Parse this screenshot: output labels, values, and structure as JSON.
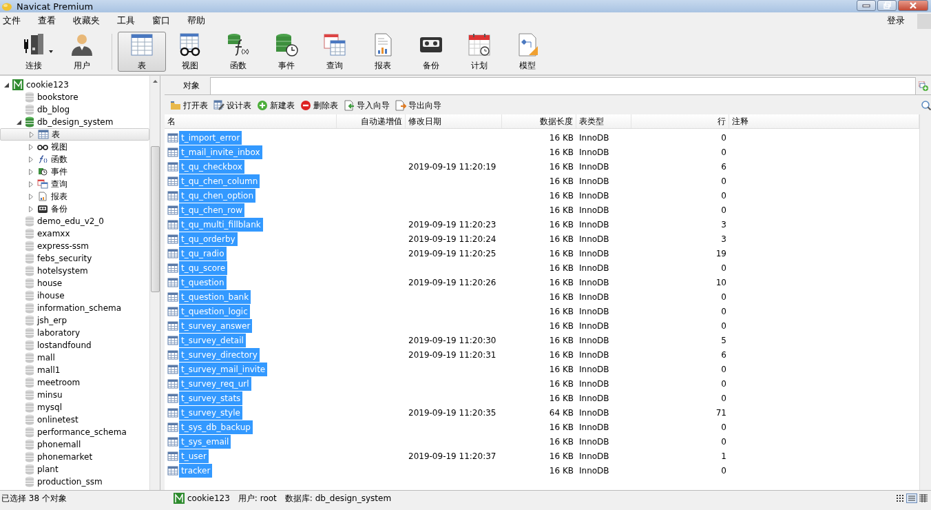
{
  "window": {
    "title": "Navicat Premium"
  },
  "menu": [
    "文件",
    "查看",
    "收藏夹",
    "工具",
    "窗口",
    "帮助"
  ],
  "login": "登录",
  "toolbar": [
    {
      "label": "连接",
      "kind": "connect",
      "selected": false,
      "dropdown": true
    },
    {
      "label": "用户",
      "kind": "user",
      "selected": false
    },
    {
      "label": "表",
      "kind": "table",
      "selected": true
    },
    {
      "label": "视图",
      "kind": "view",
      "selected": false
    },
    {
      "label": "函数",
      "kind": "function",
      "selected": false
    },
    {
      "label": "事件",
      "kind": "event",
      "selected": false
    },
    {
      "label": "查询",
      "kind": "query",
      "selected": false
    },
    {
      "label": "报表",
      "kind": "report",
      "selected": false
    },
    {
      "label": "备份",
      "kind": "backup",
      "selected": false
    },
    {
      "label": "计划",
      "kind": "schedule",
      "selected": false
    },
    {
      "label": "模型",
      "kind": "model",
      "selected": false
    }
  ],
  "sidebar": {
    "items": [
      {
        "label": "cookie123",
        "kind": "connection",
        "expanded": true,
        "selected": false,
        "children": [
          {
            "label": "bookstore",
            "kind": "database",
            "selected": false
          },
          {
            "label": "db_blog",
            "kind": "database",
            "selected": false
          },
          {
            "label": "db_design_system",
            "kind": "database",
            "expanded": true,
            "selected": false,
            "children": [
              {
                "label": "表",
                "kind": "table",
                "expanded": false,
                "selected": true
              },
              {
                "label": "视图",
                "kind": "view",
                "expanded": false,
                "selected": false
              },
              {
                "label": "函数",
                "kind": "function",
                "expanded": false,
                "selected": false
              },
              {
                "label": "事件",
                "kind": "event",
                "expanded": false,
                "selected": false
              },
              {
                "label": "查询",
                "kind": "query",
                "expanded": false,
                "selected": false
              },
              {
                "label": "报表",
                "kind": "report",
                "expanded": false,
                "selected": false
              },
              {
                "label": "备份",
                "kind": "backup",
                "expanded": false,
                "selected": false
              }
            ]
          },
          {
            "label": "demo_edu_v2_0",
            "kind": "database",
            "selected": false
          },
          {
            "label": "examxx",
            "kind": "database",
            "selected": false
          },
          {
            "label": "express-ssm",
            "kind": "database",
            "selected": false
          },
          {
            "label": "febs_security",
            "kind": "database",
            "selected": false
          },
          {
            "label": "hotelsystem",
            "kind": "database",
            "selected": false
          },
          {
            "label": "house",
            "kind": "database",
            "selected": false
          },
          {
            "label": "ihouse",
            "kind": "database",
            "selected": false
          },
          {
            "label": "information_schema",
            "kind": "database",
            "selected": false
          },
          {
            "label": "jsh_erp",
            "kind": "database",
            "selected": false
          },
          {
            "label": "laboratory",
            "kind": "database",
            "selected": false
          },
          {
            "label": "lostandfound",
            "kind": "database",
            "selected": false
          },
          {
            "label": "mall",
            "kind": "database",
            "selected": false
          },
          {
            "label": "mall1",
            "kind": "database",
            "selected": false
          },
          {
            "label": "meetroom",
            "kind": "database",
            "selected": false
          },
          {
            "label": "minsu",
            "kind": "database",
            "selected": false
          },
          {
            "label": "mysql",
            "kind": "database",
            "selected": false
          },
          {
            "label": "onlinetest",
            "kind": "database",
            "selected": false
          },
          {
            "label": "performance_schema",
            "kind": "database",
            "selected": false
          },
          {
            "label": "phonemall",
            "kind": "database",
            "selected": false
          },
          {
            "label": "phonemarket",
            "kind": "database",
            "selected": false
          },
          {
            "label": "plant",
            "kind": "database",
            "selected": false
          },
          {
            "label": "production_ssm",
            "kind": "database",
            "selected": false
          }
        ]
      }
    ]
  },
  "tabs": [
    {
      "label": "对象",
      "selected": true
    }
  ],
  "actions": [
    {
      "label": "打开表",
      "kind": "open"
    },
    {
      "label": "设计表",
      "kind": "design"
    },
    {
      "label": "新建表",
      "kind": "new"
    },
    {
      "label": "删除表",
      "kind": "delete"
    },
    {
      "label": "导入向导",
      "kind": "import"
    },
    {
      "label": "导出向导",
      "kind": "export"
    }
  ],
  "table": {
    "columns": [
      "名",
      "自动递增值",
      "修改日期",
      "数据长度",
      "表类型",
      "行",
      "注释"
    ],
    "rows": [
      {
        "name": "t_import_error",
        "size": "16 KB",
        "engine": "InnoDB",
        "rows": "0",
        "selected": true
      },
      {
        "name": "t_mail_invite_inbox",
        "size": "16 KB",
        "engine": "InnoDB",
        "rows": "0",
        "selected": true
      },
      {
        "name": "t_qu_checkbox",
        "modified": "2019-09-19 11:20:19",
        "size": "16 KB",
        "engine": "InnoDB",
        "rows": "6",
        "selected": true
      },
      {
        "name": "t_qu_chen_column",
        "size": "16 KB",
        "engine": "InnoDB",
        "rows": "0",
        "selected": true
      },
      {
        "name": "t_qu_chen_option",
        "size": "16 KB",
        "engine": "InnoDB",
        "rows": "0",
        "selected": true
      },
      {
        "name": "t_qu_chen_row",
        "size": "16 KB",
        "engine": "InnoDB",
        "rows": "0",
        "selected": true
      },
      {
        "name": "t_qu_multi_fillblank",
        "modified": "2019-09-19 11:20:23",
        "size": "16 KB",
        "engine": "InnoDB",
        "rows": "3",
        "selected": true
      },
      {
        "name": "t_qu_orderby",
        "modified": "2019-09-19 11:20:24",
        "size": "16 KB",
        "engine": "InnoDB",
        "rows": "3",
        "selected": true
      },
      {
        "name": "t_qu_radio",
        "modified": "2019-09-19 11:20:25",
        "size": "16 KB",
        "engine": "InnoDB",
        "rows": "19",
        "selected": true
      },
      {
        "name": "t_qu_score",
        "size": "16 KB",
        "engine": "InnoDB",
        "rows": "0",
        "selected": true
      },
      {
        "name": "t_question",
        "modified": "2019-09-19 11:20:26",
        "size": "16 KB",
        "engine": "InnoDB",
        "rows": "10",
        "selected": true
      },
      {
        "name": "t_question_bank",
        "size": "16 KB",
        "engine": "InnoDB",
        "rows": "0",
        "selected": true
      },
      {
        "name": "t_question_logic",
        "size": "16 KB",
        "engine": "InnoDB",
        "rows": "0",
        "selected": true
      },
      {
        "name": "t_survey_answer",
        "size": "16 KB",
        "engine": "InnoDB",
        "rows": "0",
        "selected": true
      },
      {
        "name": "t_survey_detail",
        "modified": "2019-09-19 11:20:30",
        "size": "16 KB",
        "engine": "InnoDB",
        "rows": "5",
        "selected": true
      },
      {
        "name": "t_survey_directory",
        "modified": "2019-09-19 11:20:31",
        "size": "16 KB",
        "engine": "InnoDB",
        "rows": "6",
        "selected": true
      },
      {
        "name": "t_survey_mail_invite",
        "size": "16 KB",
        "engine": "InnoDB",
        "rows": "0",
        "selected": true
      },
      {
        "name": "t_survey_req_url",
        "size": "16 KB",
        "engine": "InnoDB",
        "rows": "0",
        "selected": true
      },
      {
        "name": "t_survey_stats",
        "size": "16 KB",
        "engine": "InnoDB",
        "rows": "0",
        "selected": true
      },
      {
        "name": "t_survey_style",
        "modified": "2019-09-19 11:20:35",
        "size": "64 KB",
        "engine": "InnoDB",
        "rows": "71",
        "selected": true
      },
      {
        "name": "t_sys_db_backup",
        "size": "16 KB",
        "engine": "InnoDB",
        "rows": "0",
        "selected": true
      },
      {
        "name": "t_sys_email",
        "size": "16 KB",
        "engine": "InnoDB",
        "rows": "0",
        "selected": true
      },
      {
        "name": "t_user",
        "modified": "2019-09-19 11:20:37",
        "size": "16 KB",
        "engine": "InnoDB",
        "rows": "1",
        "selected": true
      },
      {
        "name": "tracker",
        "size": "16 KB",
        "engine": "InnoDB",
        "rows": "0",
        "selected": true
      }
    ]
  },
  "status_bar": {
    "selection": "已选择 38 个对象",
    "connection": "cookie123",
    "user": "用户: root",
    "database": "数据库: db_design_system"
  }
}
